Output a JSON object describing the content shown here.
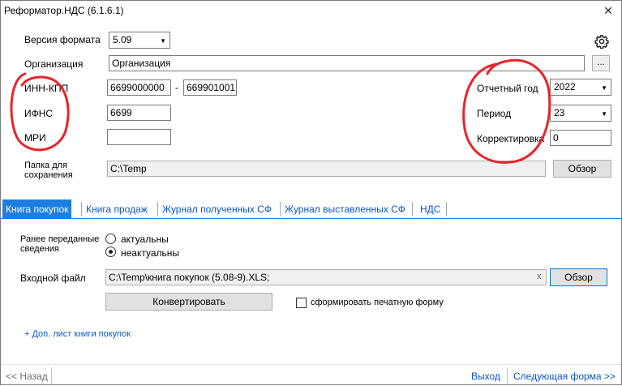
{
  "window": {
    "title": "Реформатор.НДС (6.1.6.1)",
    "close_glyph": "✕"
  },
  "icons": {
    "settings": "gear-icon",
    "dropdown": "triangle-down-icon",
    "clear": "x-icon"
  },
  "colors": {
    "accent": "#1e7ee0",
    "link": "#0a56c4",
    "annotation": "#e8242b"
  },
  "form": {
    "format_version_label": "Версия формата",
    "format_version_value": "5.09",
    "organization_label": "Организация",
    "organization_value": "Организация",
    "dots_label": "...",
    "inn_kpp_label": "ИНН-КПП",
    "inn_value": "6699000000",
    "dash": "-",
    "kpp_value": "669901001",
    "ifns_label": "ИФНС",
    "ifns_value": "6699",
    "mri_label": "МРИ",
    "mri_value": "",
    "save_folder_label": "Папка для сохранения",
    "save_folder_value": "C:\\Temp",
    "browse_label": "Обзор",
    "report_year_label": "Отчетный год",
    "report_year_value": "2022",
    "period_label": "Период",
    "period_value": "23",
    "correction_label": "Корректировка",
    "correction_value": "0"
  },
  "tabs": [
    {
      "label": "Книга покупок",
      "active": true
    },
    {
      "label": "Книга продаж",
      "active": false
    },
    {
      "label": "Журнал полученных СФ",
      "active": false
    },
    {
      "label": "Журнал выставленных СФ",
      "active": false
    },
    {
      "label": "НДС",
      "active": false
    }
  ],
  "tab_content": {
    "prev_data_label": "Ранее переданные сведения",
    "radio_actual": "актуальны",
    "radio_not_actual": "неактуальны",
    "selected_radio": "неактуальны",
    "input_file_label": "Входной файл",
    "input_file_value": "C:\\Temp\\книга покупок (5.08-9).XLS;",
    "clear_glyph": "x",
    "browse_label": "Обзор",
    "convert_label": "Конвертировать",
    "print_form_label": "сформировать печатную форму",
    "print_form_checked": false,
    "add_sheet_link": "+ Доп. лист книги покупок"
  },
  "footer": {
    "back_label": "<< Назад",
    "exit_label": "Выход",
    "next_label": "Следующая форма >>"
  }
}
